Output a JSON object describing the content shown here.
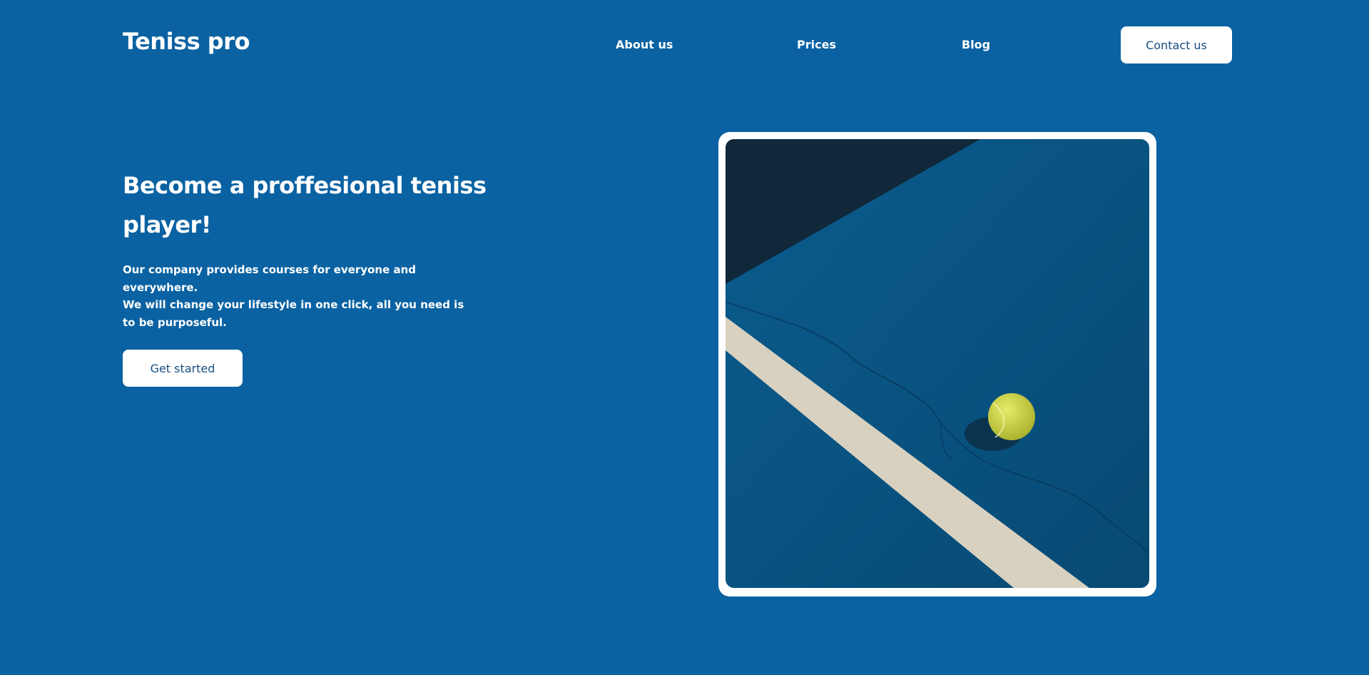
{
  "header": {
    "logo": "Teniss pro",
    "nav": {
      "about": "About us",
      "prices": "Prices",
      "blog": "Blog"
    },
    "contact_label": "Contact us"
  },
  "hero": {
    "title": "Become a proffesional teniss player!",
    "paragraph_1": "Our company provides courses for everyone and everywhere.",
    "paragraph_2": "We will change your lifestyle in one click, all you need is to be purposeful.",
    "cta_label": "Get started"
  },
  "colors": {
    "background": "#0a62a2",
    "button_bg": "#ffffff",
    "button_text": "#1a4e80",
    "court": "#0a5686",
    "court_shadow": "#0f2a3d",
    "court_line": "#dcd5c6",
    "ball": "#d6dd4a"
  },
  "icons": {
    "hero_image": "tennis-court-photo"
  }
}
